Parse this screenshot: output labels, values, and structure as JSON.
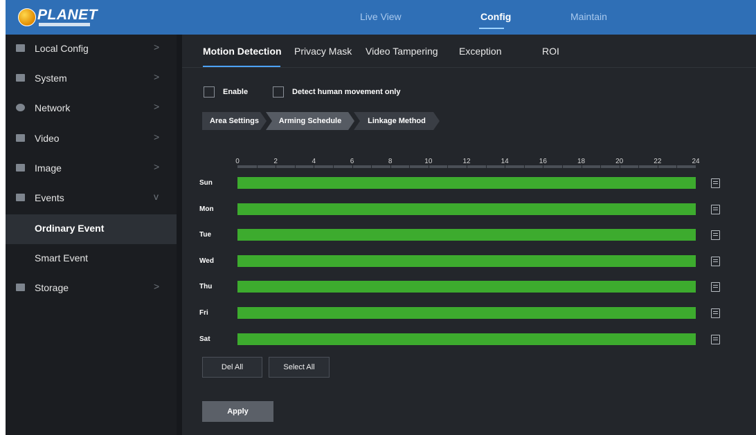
{
  "brand": {
    "logo_text": "PLANET"
  },
  "top_nav": [
    {
      "label": "Live View",
      "active": false
    },
    {
      "label": "Config",
      "active": true
    },
    {
      "label": "Maintain",
      "active": false
    }
  ],
  "sidebar": {
    "items": [
      {
        "label": "Local Config",
        "icon": "monitor-icon",
        "chevron": ">"
      },
      {
        "label": "System",
        "icon": "system-icon",
        "chevron": ">"
      },
      {
        "label": "Network",
        "icon": "network-icon",
        "chevron": ">"
      },
      {
        "label": "Video",
        "icon": "video-icon",
        "chevron": ">"
      },
      {
        "label": "Image",
        "icon": "image-icon",
        "chevron": ">"
      },
      {
        "label": "Events",
        "icon": "events-icon",
        "chevron": "v"
      }
    ],
    "sub_items": [
      {
        "label": "Ordinary Event",
        "active": true
      },
      {
        "label": "Smart Event",
        "active": false
      }
    ],
    "storage": {
      "label": "Storage",
      "icon": "storage-icon",
      "chevron": ">"
    }
  },
  "tabs": [
    {
      "label": "Motion Detection",
      "active": true
    },
    {
      "label": "Privacy Mask",
      "active": false
    },
    {
      "label": "Video Tampering",
      "active": false
    },
    {
      "label": "Exception",
      "active": false
    },
    {
      "label": "ROI",
      "active": false
    }
  ],
  "options": {
    "enable_label": "Enable",
    "enable_checked": false,
    "human_label": "Detect human movement only",
    "human_checked": false
  },
  "steps": [
    {
      "label": "Area Settings",
      "active": false
    },
    {
      "label": "Arming Schedule",
      "active": true
    },
    {
      "label": "Linkage Method",
      "active": false
    }
  ],
  "schedule": {
    "hour_labels": [
      "0",
      "2",
      "4",
      "6",
      "8",
      "10",
      "12",
      "14",
      "16",
      "18",
      "20",
      "22",
      "24"
    ],
    "days": [
      {
        "label": "Sun",
        "armed_from": 0,
        "armed_to": 24
      },
      {
        "label": "Mon",
        "armed_from": 0,
        "armed_to": 24
      },
      {
        "label": "Tue",
        "armed_from": 0,
        "armed_to": 24
      },
      {
        "label": "Wed",
        "armed_from": 0,
        "armed_to": 24
      },
      {
        "label": "Thu",
        "armed_from": 0,
        "armed_to": 24
      },
      {
        "label": "Fri",
        "armed_from": 0,
        "armed_to": 24
      },
      {
        "label": "Sat",
        "armed_from": 0,
        "armed_to": 24
      }
    ],
    "armed_color": "#3dab2e"
  },
  "buttons": {
    "del_all": "Del All",
    "select_all": "Select All",
    "apply": "Apply"
  },
  "colors": {
    "header_blue": "#2f6fb6",
    "accent": "#4da3ff"
  }
}
